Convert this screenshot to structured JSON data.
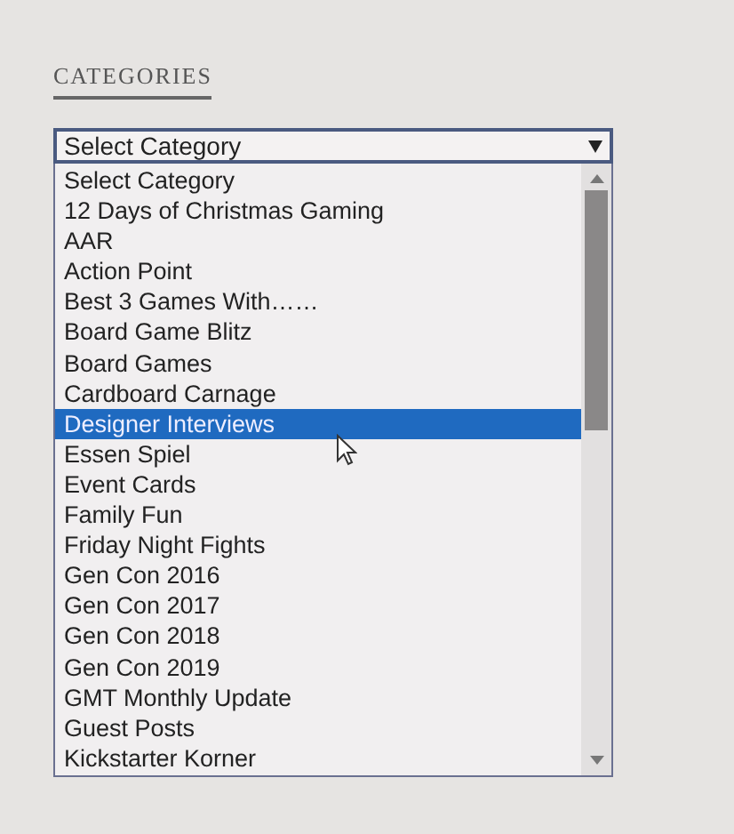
{
  "heading": "CATEGORIES",
  "select": {
    "value": "Select Category",
    "expanded": true
  },
  "options": [
    {
      "label": "Select Category",
      "selected": false
    },
    {
      "label": "12 Days of Christmas Gaming",
      "selected": false
    },
    {
      "label": "AAR",
      "selected": false
    },
    {
      "label": "Action Point",
      "selected": false
    },
    {
      "label": "Best 3 Games With……",
      "selected": false
    },
    {
      "label": "Board Game Blitz",
      "selected": false
    },
    {
      "label": "Board Games",
      "selected": false
    },
    {
      "label": "Cardboard Carnage",
      "selected": false
    },
    {
      "label": "Designer Interviews",
      "selected": true
    },
    {
      "label": "Essen Spiel",
      "selected": false
    },
    {
      "label": "Event Cards",
      "selected": false
    },
    {
      "label": "Family Fun",
      "selected": false
    },
    {
      "label": "Friday Night Fights",
      "selected": false
    },
    {
      "label": "Gen Con 2016",
      "selected": false
    },
    {
      "label": "Gen Con 2017",
      "selected": false
    },
    {
      "label": "Gen Con 2018",
      "selected": false
    },
    {
      "label": "Gen Con 2019",
      "selected": false
    },
    {
      "label": "GMT Monthly Update",
      "selected": false
    },
    {
      "label": "Guest Posts",
      "selected": false
    },
    {
      "label": "Kickstarter Korner",
      "selected": false
    }
  ]
}
